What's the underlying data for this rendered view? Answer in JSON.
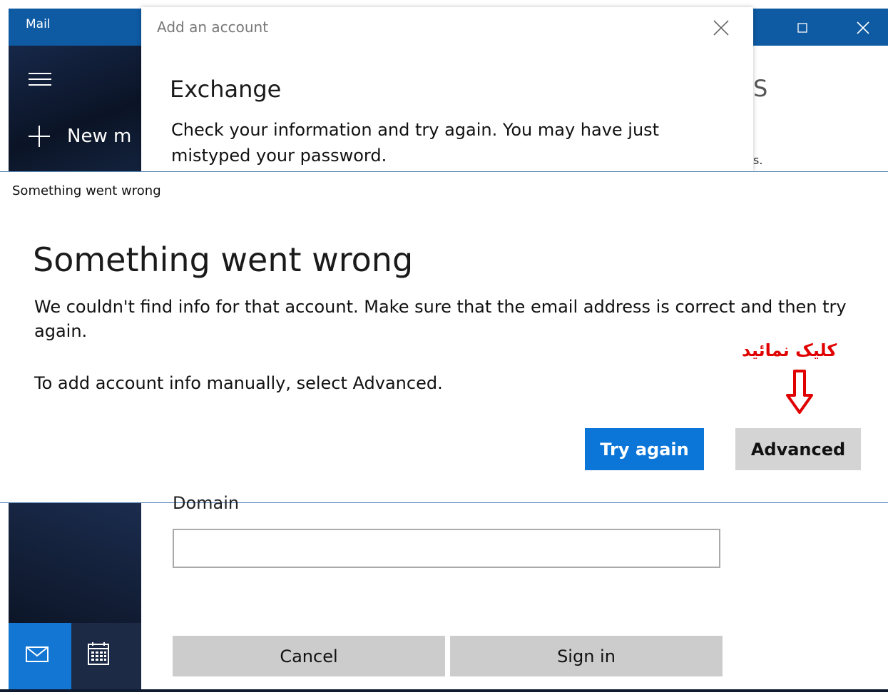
{
  "mail_app": {
    "title": "Mail",
    "new_mail_label": "New m",
    "right_fragment": "S",
    "right_fragment_2": "s."
  },
  "add_account_top": {
    "header": "Add an account",
    "title": "Exchange",
    "message": "Check your information and try again. You may have just mistyped your password."
  },
  "error_dialog": {
    "caption": "Something went wrong",
    "title": "Something went wrong",
    "message": "We couldn't find info for that account. Make sure that the email address is correct and then try again.",
    "manual_hint": "To add account info manually, select Advanced.",
    "try_again_label": "Try again",
    "advanced_label": "Advanced"
  },
  "annotation": {
    "text": "کلیک نمائید",
    "color": "#e00000"
  },
  "add_account_bottom": {
    "domain_label": "Domain",
    "domain_value": "",
    "cancel_label": "Cancel",
    "signin_label": "Sign in"
  },
  "colors": {
    "accent": "#0b76d8",
    "titlebar": "#0e5aa3"
  }
}
